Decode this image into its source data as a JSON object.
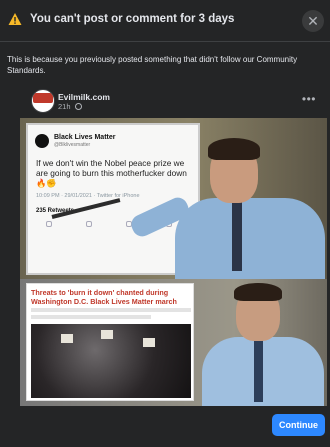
{
  "dialog": {
    "title": "You can't post or comment for 3 days",
    "close_icon": "close-icon",
    "warning_icon": "warning-icon",
    "message": "This is because you previously posted something that didn't follow our Community Standards.",
    "continue_label": "Continue"
  },
  "post": {
    "page_name": "Evilmilk.com",
    "avatar_text": "EVILMILK",
    "time": "21h",
    "audience_icon": "globe-icon",
    "more_icon": "more-options-icon",
    "tweet": {
      "account": "Black Lives Matter",
      "handle": "@Blklivesmatter",
      "text": "If we don't win the Nobel peace prize we are going to burn this motherfucker down 🔥✊",
      "meta": "10:09 PM · 29/01/2021 · Twitter for iPhone",
      "retweets": "235 Retweets"
    },
    "article_title": "Threats to 'burn it down' chanted during Washington D.C. Black Lives Matter march"
  },
  "colors": {
    "background": "#242526",
    "accent": "#2d88ff",
    "warning": "#f7b928"
  }
}
